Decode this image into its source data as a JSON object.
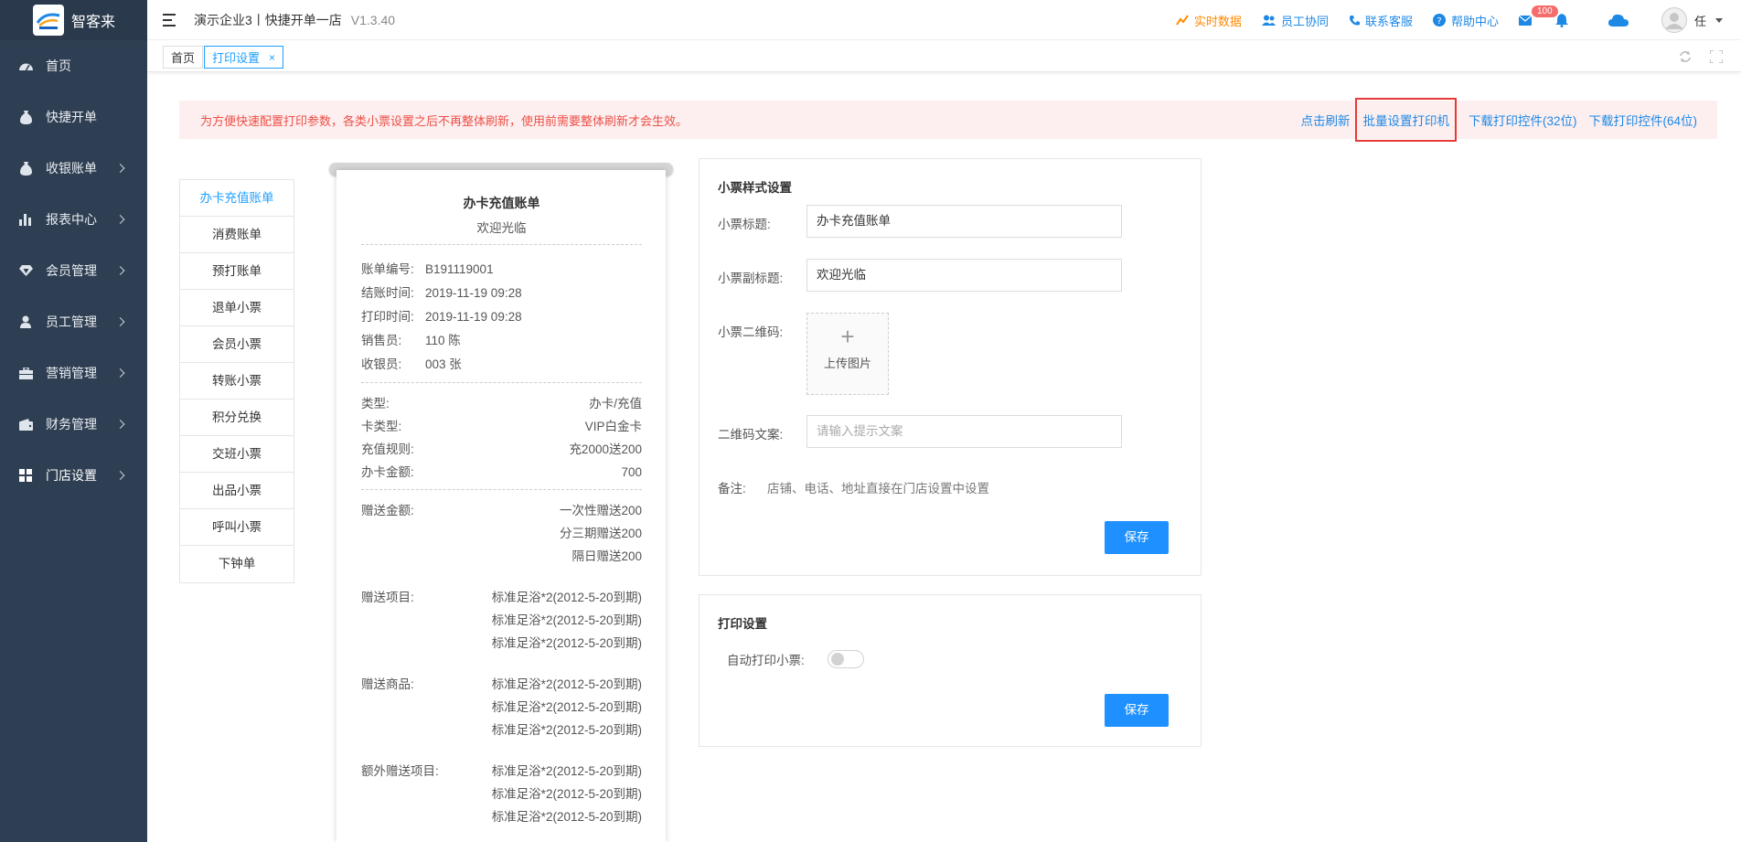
{
  "brand": {
    "name": "智客来",
    "logo_text": "智客来"
  },
  "sidebar": {
    "items": [
      {
        "label": "首页",
        "icon": "gauge-icon",
        "arrow": false
      },
      {
        "label": "快捷开单",
        "icon": "moneybag-icon",
        "arrow": false
      },
      {
        "label": "收银账单",
        "icon": "moneybag-icon",
        "arrow": true
      },
      {
        "label": "报表中心",
        "icon": "bar-chart-icon",
        "arrow": true
      },
      {
        "label": "会员管理",
        "icon": "diamond-icon",
        "arrow": true
      },
      {
        "label": "员工管理",
        "icon": "user-icon",
        "arrow": true
      },
      {
        "label": "营销管理",
        "icon": "briefcase-icon",
        "arrow": true
      },
      {
        "label": "财务管理",
        "icon": "wallet-icon",
        "arrow": true
      },
      {
        "label": "门店设置",
        "icon": "grid-icon",
        "arrow": true
      }
    ]
  },
  "header": {
    "title": "演示企业3丨快捷开单一店",
    "version": "V1.3.40",
    "realtime": "实时数据",
    "staff": "员工协同",
    "service": "联系客服",
    "help": "帮助中心",
    "mail_badge": "100",
    "user": "任"
  },
  "tabs": {
    "home": "首页",
    "print": "打印设置",
    "close": "×"
  },
  "notice": {
    "text": "为方便快速配置打印参数，各类小票设置之后不再整体刷新，使用前需要整体刷新才会生效。",
    "refresh": "点击刷新",
    "batch": "批量设置打印机",
    "dl32": "下载打印控件(32位)",
    "dl64": "下载打印控件(64位)"
  },
  "ticket_menu": [
    "办卡充值账单",
    "消费账单",
    "预打账单",
    "退单小票",
    "会员小票",
    "转账小票",
    "积分兑换",
    "交班小票",
    "出品小票",
    "呼叫小票",
    "下钟单"
  ],
  "receipt": {
    "title": "办卡充值账单",
    "subtitle": "欢迎光临",
    "info": [
      {
        "k": "账单编号:",
        "v": "B191119001"
      },
      {
        "k": "结账时间:",
        "v": "2019-11-19 09:28"
      },
      {
        "k": "打印时间:",
        "v": "2019-11-19 09:28"
      },
      {
        "k": "销售员:",
        "v": "110 陈"
      },
      {
        "k": "收银员:",
        "v": "003 张"
      }
    ],
    "detail": [
      {
        "k": "类型:",
        "v": "办卡/充值"
      },
      {
        "k": "卡类型:",
        "v": "VIP白金卡"
      },
      {
        "k": "充值规则:",
        "v": "充2000送200"
      },
      {
        "k": "办卡金额:",
        "v": "700"
      }
    ],
    "gift_amount": {
      "k": "赠送金额:",
      "lines": [
        "一次性赠送200",
        "分三期赠送200",
        "隔日赠送200"
      ]
    },
    "gift_items": {
      "k": "赠送项目:",
      "lines": [
        "标准足浴*2(2012-5-20到期)",
        "标准足浴*2(2012-5-20到期)",
        "标准足浴*2(2012-5-20到期)"
      ]
    },
    "gift_goods": {
      "k": "赠送商品:",
      "lines": [
        "标准足浴*2(2012-5-20到期)",
        "标准足浴*2(2012-5-20到期)",
        "标准足浴*2(2012-5-20到期)"
      ]
    },
    "extra_items": {
      "k": "额外赠送项目:",
      "lines": [
        "标准足浴*2(2012-5-20到期)",
        "标准足浴*2(2012-5-20到期)",
        "标准足浴*2(2012-5-20到期)"
      ]
    }
  },
  "style_panel": {
    "title": "小票样式设置",
    "title_label": "小票标题:",
    "title_value": "办卡充值账单",
    "subtitle_label": "小票副标题:",
    "subtitle_value": "欢迎光临",
    "qr_label": "小票二维码:",
    "upload_plus": "+",
    "upload_text": "上传图片",
    "qr_text_label": "二维码文案:",
    "qr_text_placeholder": "请输入提示文案",
    "note_label": "备注:",
    "note_text": "店铺、电话、地址直接在门店设置中设置",
    "save": "保存"
  },
  "print_panel": {
    "title": "打印设置",
    "auto_label": "自动打印小票:",
    "auto_on": false,
    "save": "保存"
  },
  "colors": {
    "sidebar": "#2f3f53",
    "accent": "#1e90ff",
    "notice_bg": "#fdeff0",
    "notice_text": "#ed4f45",
    "orange": "#ff8a00"
  }
}
